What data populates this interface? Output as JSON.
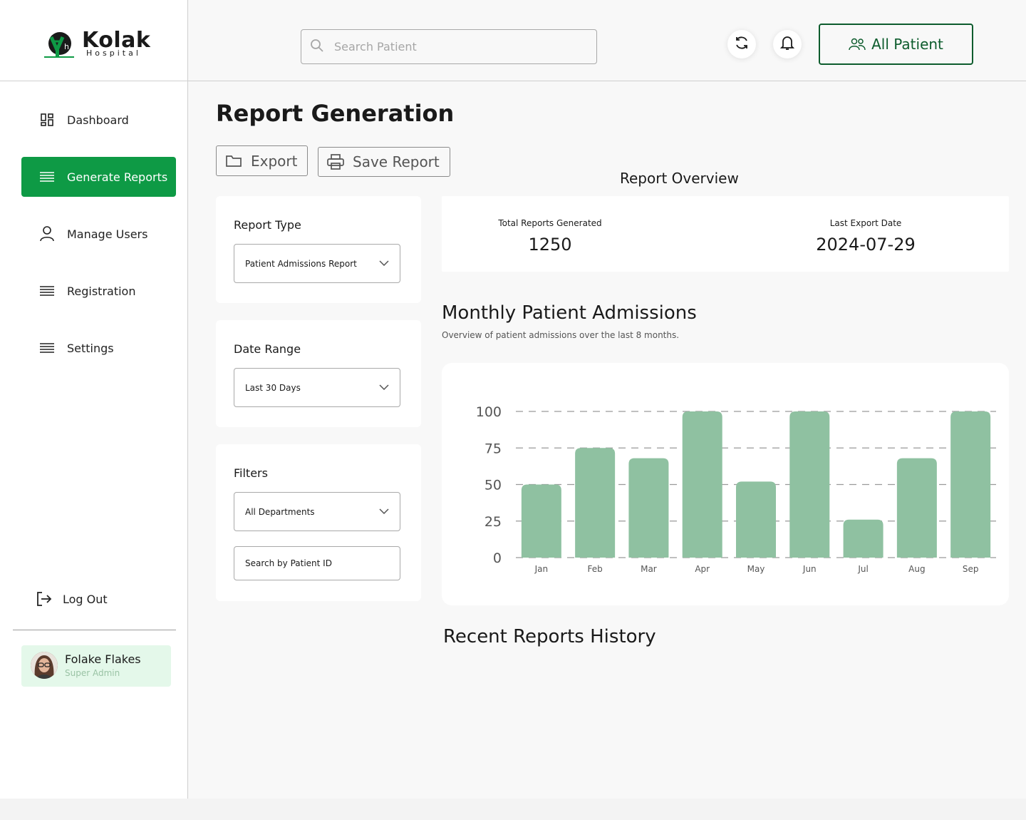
{
  "brand": {
    "name": "Kolak",
    "subtitle": "Hospital"
  },
  "sidebar": {
    "items": [
      {
        "label": "Dashboard",
        "icon": "dashboard-icon"
      },
      {
        "label": "Generate Reports",
        "icon": "list-icon",
        "active": true
      },
      {
        "label": "Manage Users",
        "icon": "user-icon"
      },
      {
        "label": "Registration",
        "icon": "list-icon"
      },
      {
        "label": "Settings",
        "icon": "list-icon"
      }
    ],
    "logout_label": "Log Out"
  },
  "user": {
    "name": "Folake Flakes",
    "role": "Super Admin"
  },
  "topbar": {
    "search_placeholder": "Search Patient",
    "all_patient_label": "All Patient"
  },
  "page": {
    "title": "Report Generation",
    "export_label": "Export",
    "save_label": "Save Report"
  },
  "filters": {
    "report_type_label": "Report Type",
    "report_type_value": "Patient Admissions Report",
    "date_range_label": "Date Range",
    "date_range_value": "Last 30 Days",
    "filters_label": "Filters",
    "department_value": "All Departments",
    "patient_id_placeholder": "Search by Patient ID"
  },
  "overview": {
    "title": "Report Overview",
    "total_label": "Total Reports Generated",
    "total_value": "1250",
    "last_export_label": "Last Export Date",
    "last_export_value": "2024-07-29"
  },
  "chart_section": {
    "heading": "Monthly Patient Admissions",
    "subtitle": "Overview of patient admissions over the last 8 months."
  },
  "recent": {
    "title": "Recent Reports History"
  },
  "colors": {
    "accent": "#0e9a45",
    "accent_dark": "#0d5c2d",
    "bar": "#8fc1a1",
    "user_card": "#e4f8ea"
  },
  "chart_data": {
    "type": "bar",
    "categories": [
      "Jan",
      "Feb",
      "Mar",
      "Apr",
      "May",
      "Jun",
      "Jul",
      "Aug",
      "Sep"
    ],
    "values": [
      50,
      75,
      68,
      100,
      52,
      100,
      26,
      68,
      100
    ],
    "yticks": [
      0,
      25,
      50,
      75,
      100
    ],
    "ylim": [
      0,
      100
    ],
    "grid": "dashed horizontal",
    "title": "",
    "xlabel": "",
    "ylabel": ""
  }
}
